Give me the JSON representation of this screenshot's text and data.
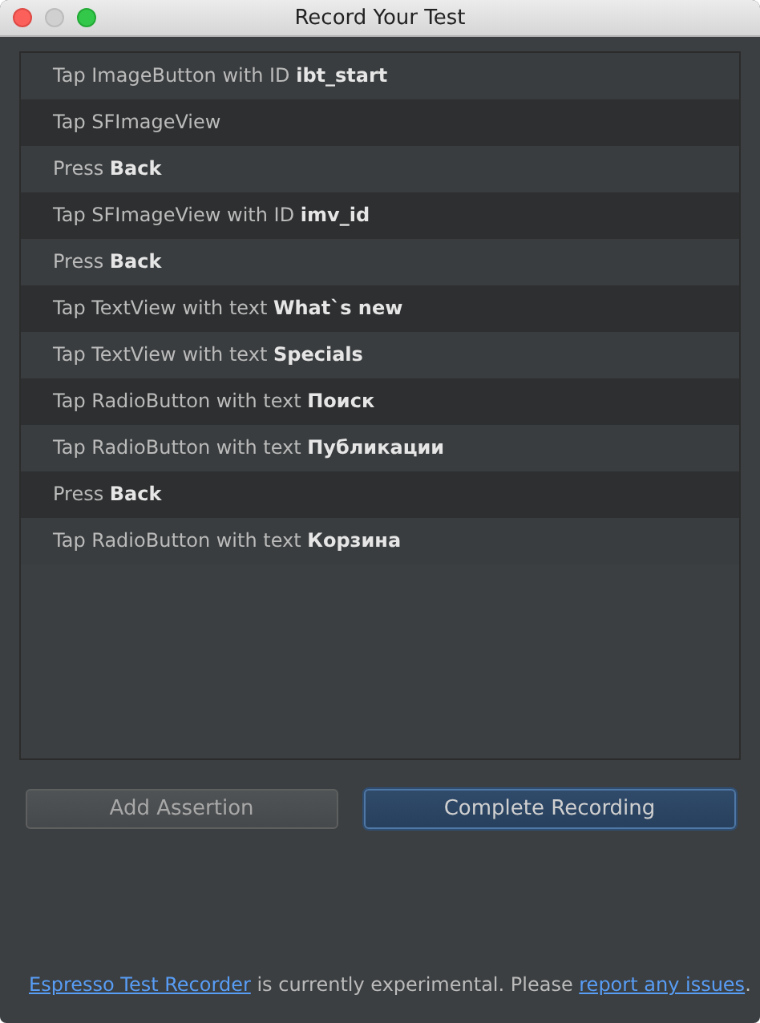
{
  "window": {
    "title": "Record Your Test"
  },
  "steps": [
    {
      "text": "Tap ImageButton with ID **ibt_start**"
    },
    {
      "text": "Tap SFImageView"
    },
    {
      "text": "Press **Back**"
    },
    {
      "text": "Tap SFImageView with ID **imv_id**"
    },
    {
      "text": "Press **Back**"
    },
    {
      "text": "Tap TextView with text **What`s new**"
    },
    {
      "text": "Tap TextView with text **Specials**"
    },
    {
      "text": "Tap RadioButton with text **Поиск**"
    },
    {
      "text": "Tap RadioButton with text **Публикации**"
    },
    {
      "text": "Press **Back**"
    },
    {
      "text": "Tap RadioButton with text **Корзина**"
    }
  ],
  "buttons": [
    {
      "label": "Add Assertion",
      "kind": "normal"
    },
    {
      "label": "Complete Recording",
      "kind": "default"
    }
  ],
  "footer": {
    "link_1": "Espresso Test Recorder",
    "middle": " is currently experimental. Please ",
    "link_2": "report any issues",
    "end": "."
  }
}
